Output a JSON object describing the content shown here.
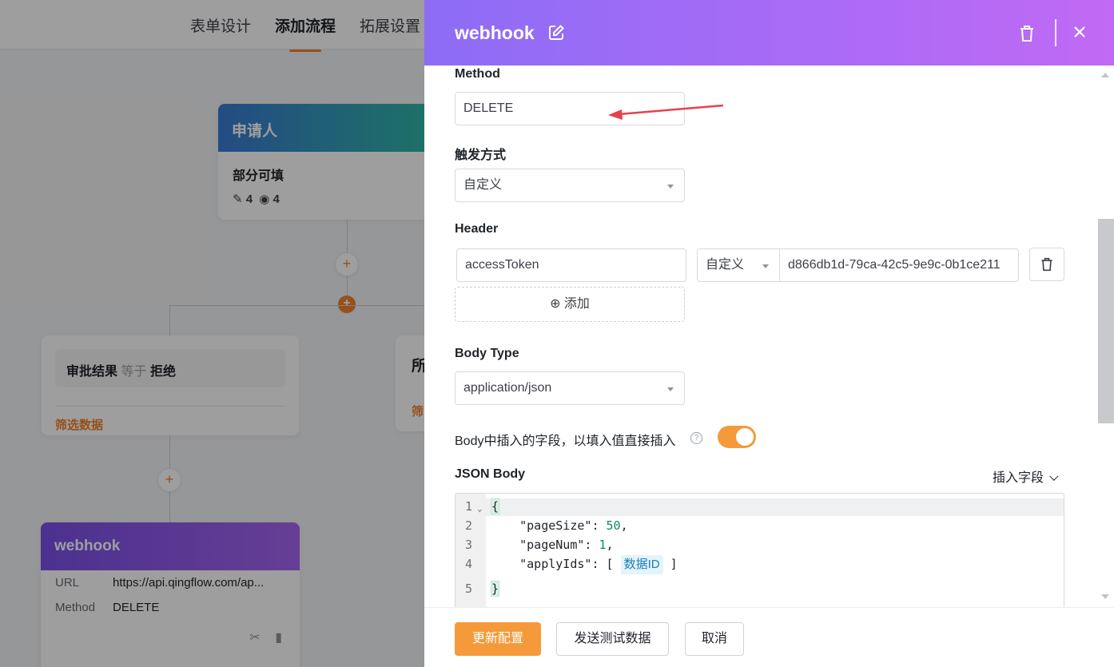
{
  "colors": {
    "accent": "#f59a3a",
    "drawer_header_start": "#8d6cf6",
    "drawer_header_end": "#c06af5",
    "applicant_start": "#3a7bd5",
    "applicant_end": "#2fb9a5",
    "webhook_node": "#7b4fe8"
  },
  "topnav": {
    "tabs": [
      {
        "label": "表单设计"
      },
      {
        "label": "添加流程",
        "active": true
      },
      {
        "label": "拓展设置"
      }
    ]
  },
  "flow": {
    "applicant": {
      "title": "申请人",
      "subtitle": "部分可填",
      "edit_count": "4",
      "view_count": "4"
    },
    "condition": {
      "field": "审批结果",
      "operator": "等于",
      "value": "拒绝",
      "filter_label": "筛选数据"
    },
    "condition2": {
      "title": "所",
      "filter_label": "筛"
    },
    "webhook": {
      "title": "webhook",
      "url_key": "URL",
      "url_value": "https://api.qingflow.com/ap...",
      "method_key": "Method",
      "method_value": "DELETE"
    }
  },
  "drawer": {
    "title": "webhook",
    "method": {
      "label": "Method",
      "value": "DELETE"
    },
    "trigger": {
      "label": "触发方式",
      "value": "自定义"
    },
    "header": {
      "label": "Header",
      "key": "accessToken",
      "type": "自定义",
      "value": "d866db1d-79ca-42c5-9e9c-0b1ce211",
      "add_label": "添加"
    },
    "body_type": {
      "label": "Body Type",
      "value": "application/json"
    },
    "insert_toggle": {
      "label": "Body中插入的字段，以填入值直接插入",
      "on": true
    },
    "json_body": {
      "label": "JSON Body",
      "insert_field_label": "插入字段",
      "line_numbers": [
        "1",
        "2",
        "3",
        "4",
        "5"
      ],
      "lines": {
        "l1": "{",
        "l2_key": "\"pageSize\"",
        "l2_val": "50",
        "l3_key": "\"pageNum\"",
        "l3_val": "1",
        "l4_key": "\"applyIds\"",
        "l4_tag": "数据ID",
        "l5": "}"
      }
    },
    "footer": {
      "update_label": "更新配置",
      "test_label": "发送测试数据",
      "cancel_label": "取消"
    }
  }
}
